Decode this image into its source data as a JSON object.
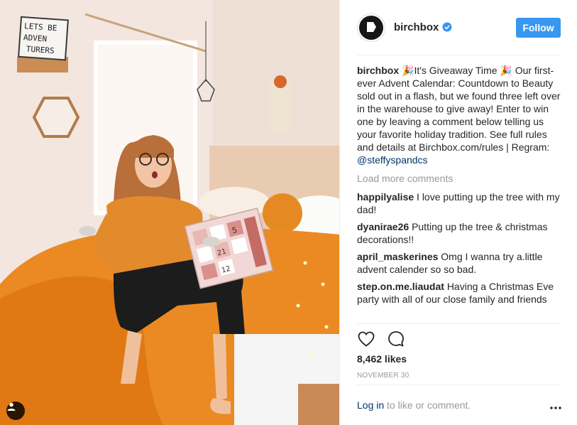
{
  "post": {
    "account": {
      "username": "birchbox",
      "verified": true,
      "follow_label": "Follow"
    },
    "caption": {
      "username": "birchbox",
      "text": "🎉It's Giveaway Time 🎉 Our first-ever Advent Calendar: Countdown to Beauty sold out in a flash, but we found three left over in the warehouse to give away! Enter to win one by leaving a comment below telling us your favorite holiday tradition. See full rules and details at Birchbox.com/rules | Regram: ",
      "mention": "@steffyspandcs"
    },
    "load_more_label": "Load more comments",
    "comments": [
      {
        "username": "happilyalise",
        "text": "I love putting up the tree with my dad!"
      },
      {
        "username": "dyanirae26",
        "text": "Putting up the tree & christmas decorations!!"
      },
      {
        "username": "april_maskerines",
        "text": "Omg I wanna try a.little advent calender so so bad."
      },
      {
        "username": "step.on.me.liaudat",
        "text": "Having a Christmas Eve party with all of our close family and friends"
      }
    ],
    "likes": "8,462 likes",
    "date": "NOVEMBER 30",
    "login": {
      "link": "Log in",
      "rest": "to like or comment."
    }
  },
  "photo": {
    "sign_text": [
      "LETS BE",
      "ADVEN",
      "TURERS"
    ],
    "calendar_numbers": [
      "5",
      "21",
      "12"
    ]
  },
  "icons": {
    "avatar": "birchbox-logo-icon",
    "verified": "verified-badge-icon",
    "like": "heart-icon",
    "comment": "comment-bubble-icon",
    "user_tag": "user-tag-icon",
    "more": "more-options-icon"
  },
  "colors": {
    "follow_button": "#3897f0",
    "mention": "#003569",
    "muted": "#999999",
    "verified": "#3897f0"
  }
}
